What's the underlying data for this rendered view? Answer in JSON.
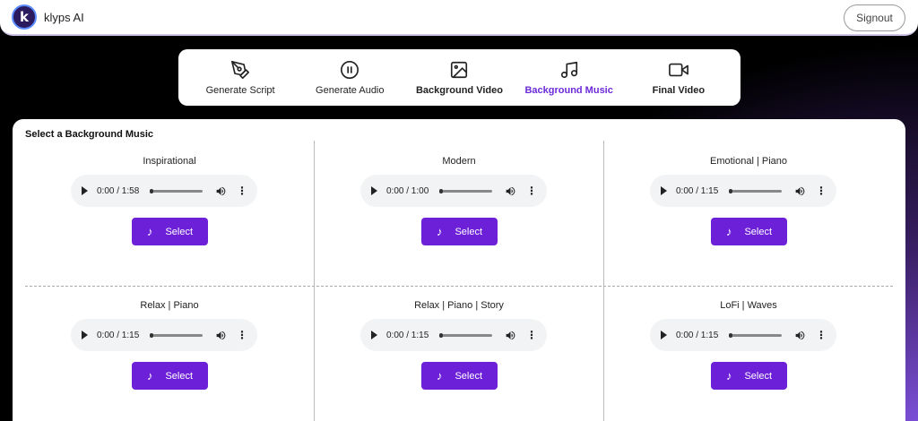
{
  "header": {
    "app_name": "klyps AI",
    "logo_letter": "k",
    "signout_label": "Signout"
  },
  "steps": [
    {
      "label": "Generate Script",
      "icon": "pen-icon",
      "state": "normal"
    },
    {
      "label": "Generate Audio",
      "icon": "pause-circle-icon",
      "state": "normal"
    },
    {
      "label": "Background Video",
      "icon": "image-icon",
      "state": "bold"
    },
    {
      "label": "Background Music",
      "icon": "music-note-icon",
      "state": "active"
    },
    {
      "label": "Final Video",
      "icon": "video-camera-icon",
      "state": "bold"
    }
  ],
  "panel": {
    "title": "Select a Background Music",
    "select_label": "Select",
    "tracks": [
      {
        "title": "Inspirational",
        "time": "0:00 / 1:58"
      },
      {
        "title": "Modern",
        "time": "0:00 / 1:00"
      },
      {
        "title": "Emotional | Piano",
        "time": "0:00 / 1:15"
      },
      {
        "title": "Relax | Piano",
        "time": "0:00 / 1:15"
      },
      {
        "title": "Relax | Piano | Story",
        "time": "0:00 / 1:15"
      },
      {
        "title": "LoFi | Waves",
        "time": "0:00 / 1:15"
      }
    ]
  },
  "colors": {
    "accent": "#6c20d8",
    "active_step": "#6c2bd9"
  }
}
